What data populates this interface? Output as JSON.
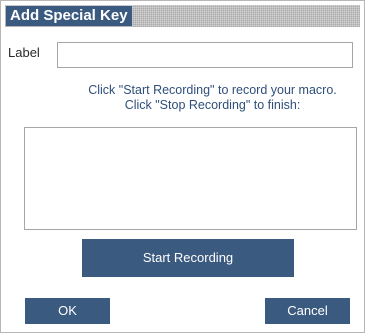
{
  "dialog": {
    "title": "Add Special Key"
  },
  "label_field": {
    "label": "Label",
    "value": ""
  },
  "instructions": {
    "line1": "Click \"Start Recording\" to record your macro.",
    "line2": "Click \"Stop Recording\" to finish:"
  },
  "macro_area": {
    "value": ""
  },
  "buttons": {
    "record": "Start Recording",
    "ok": "OK",
    "cancel": "Cancel"
  },
  "colors": {
    "accent": "#3b5a80",
    "instruction_text": "#2f4f7a",
    "title_bar": "#d4d4d4",
    "border": "#a6a6a6"
  }
}
